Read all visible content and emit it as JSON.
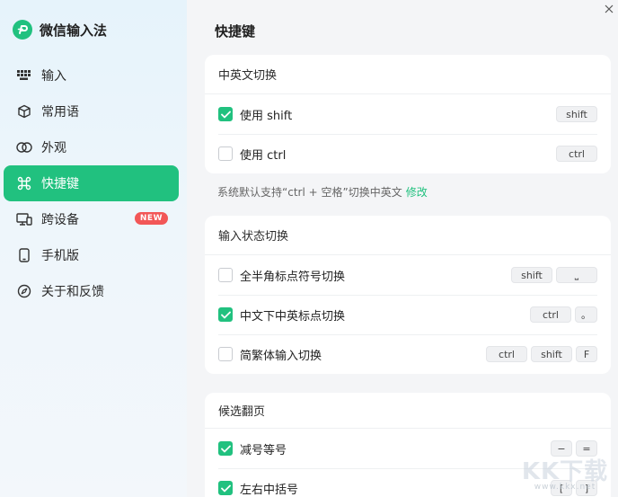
{
  "app": {
    "title": "微信输入法"
  },
  "sidebar": {
    "items": [
      {
        "label": "输入",
        "icon": "keyboard-icon"
      },
      {
        "label": "常用语",
        "icon": "cube-icon"
      },
      {
        "label": "外观",
        "icon": "overlap-circles-icon"
      },
      {
        "label": "快捷键",
        "icon": "command-icon",
        "active": true
      },
      {
        "label": "跨设备",
        "icon": "devices-icon",
        "badge": "NEW"
      },
      {
        "label": "手机版",
        "icon": "phone-icon"
      },
      {
        "label": "关于和反馈",
        "icon": "compass-icon"
      }
    ]
  },
  "main": {
    "title": "快捷键",
    "sections": [
      {
        "header": "中英文切换",
        "rows": [
          {
            "label": "使用 shift",
            "checked": true,
            "keys": [
              "shift"
            ]
          },
          {
            "label": "使用 ctrl",
            "checked": false,
            "keys": [
              "ctrl"
            ]
          }
        ]
      },
      {
        "header": "输入状态切换",
        "rows": [
          {
            "label": "全半角标点符号切换",
            "checked": false,
            "keys": [
              "shift",
              "⎵"
            ]
          },
          {
            "label": "中文下中英标点切换",
            "checked": true,
            "keys": [
              "ctrl",
              "。"
            ]
          },
          {
            "label": "简繁体输入切换",
            "checked": false,
            "keys": [
              "ctrl",
              "shift",
              "F"
            ]
          }
        ]
      },
      {
        "header": "候选翻页",
        "rows": [
          {
            "label": "减号等号",
            "checked": true,
            "keys": [
              "−",
              "="
            ]
          },
          {
            "label": "左右中括号",
            "checked": true,
            "keys": [
              "[",
              "]"
            ]
          }
        ]
      }
    ],
    "note": {
      "text": "系统默认支持“ctrl + 空格”切换中英文",
      "link": "修改"
    }
  },
  "watermark": {
    "main": "KK下载",
    "sub": "www.kkx.net"
  },
  "colors": {
    "accent": "#21c17f",
    "badge": "#f25757"
  }
}
